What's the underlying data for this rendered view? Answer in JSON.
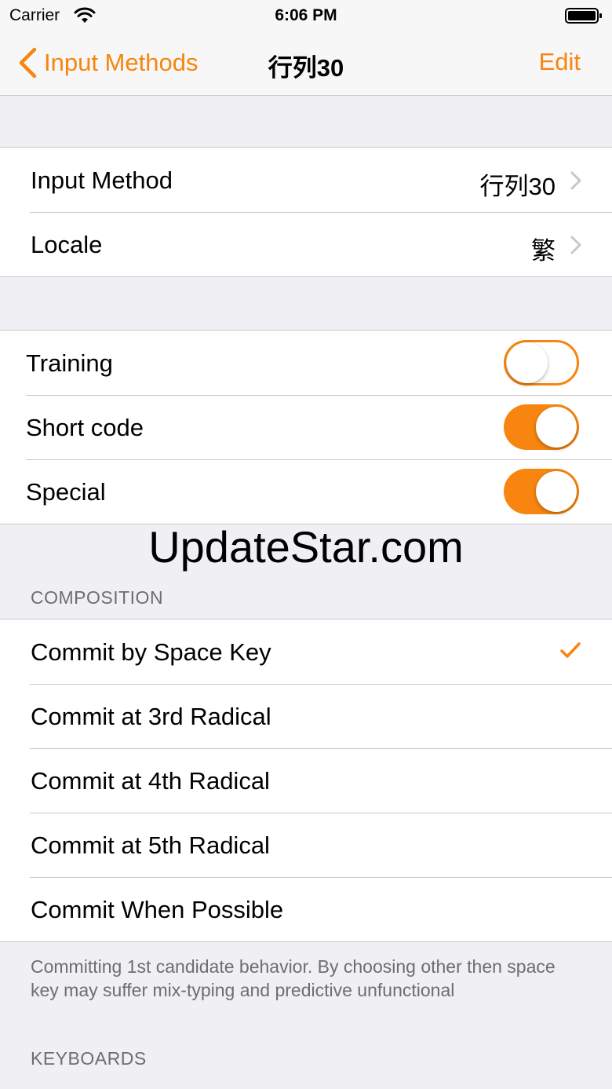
{
  "status_bar": {
    "carrier": "Carrier",
    "time": "6:06 PM"
  },
  "nav": {
    "back_label": "Input Methods",
    "title": "行列30",
    "edit_label": "Edit"
  },
  "settings": [
    {
      "label": "Input Method",
      "value": "行列30"
    },
    {
      "label": "Locale",
      "value": "繁"
    }
  ],
  "toggles": [
    {
      "label": "Training",
      "on": false
    },
    {
      "label": "Short code",
      "on": true
    },
    {
      "label": "Special",
      "on": true
    }
  ],
  "watermark": "UpdateStar.com",
  "composition": {
    "header": "COMPOSITION",
    "options": [
      {
        "label": "Commit by Space Key",
        "selected": true
      },
      {
        "label": "Commit at 3rd Radical",
        "selected": false
      },
      {
        "label": "Commit at 4th Radical",
        "selected": false
      },
      {
        "label": "Commit at 5th Radical",
        "selected": false
      },
      {
        "label": "Commit When Possible",
        "selected": false
      }
    ],
    "footer": "Committing 1st candidate behavior. By choosing other then space key may suffer mix-typing and predictive unfunctional"
  },
  "keyboards": {
    "header": "KEYBOARDS"
  },
  "colors": {
    "accent": "#f7850f",
    "background": "#efeff4",
    "secondary_text": "#6d6d72"
  }
}
